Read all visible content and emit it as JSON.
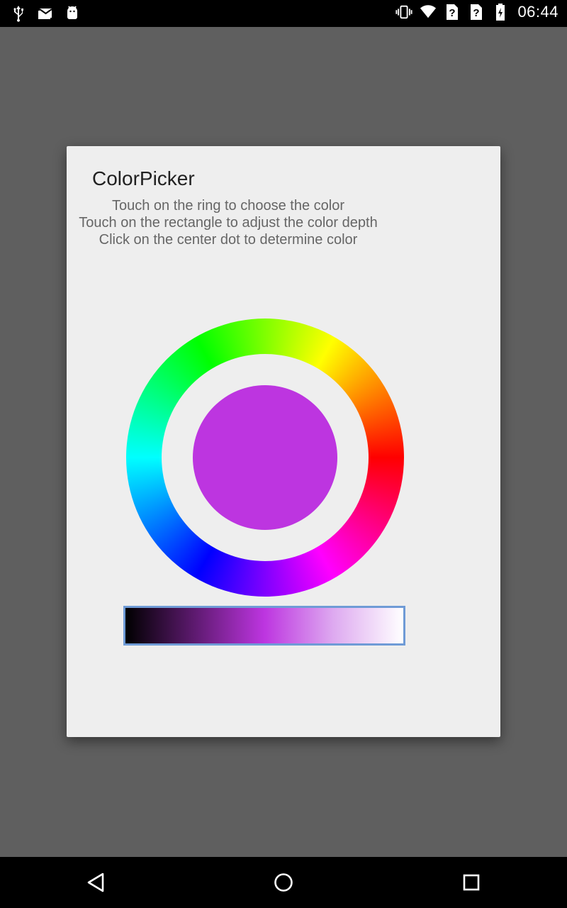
{
  "status_bar": {
    "time": "06:44",
    "left_icons": [
      "usb-icon",
      "email-icon",
      "android-debug-icon"
    ],
    "right_icons": [
      "vibrate-icon",
      "wifi-icon",
      "sim-unknown-icon",
      "sim-unknown-icon",
      "battery-icon"
    ]
  },
  "dialog": {
    "title": "ColorPicker",
    "instructions": [
      "Touch on the ring to choose the color",
      "Touch on the rectangle to adjust the color depth",
      "Click on the center dot to determine color"
    ],
    "selected_color": "#bd35e0"
  },
  "colors": {
    "scrim": "#5f5f5f",
    "dialog_bg": "#eeeeee",
    "depth_bar_border": "#6f9bd6"
  },
  "nav_bar": {
    "buttons": [
      "back-icon",
      "home-icon",
      "recents-icon"
    ]
  }
}
